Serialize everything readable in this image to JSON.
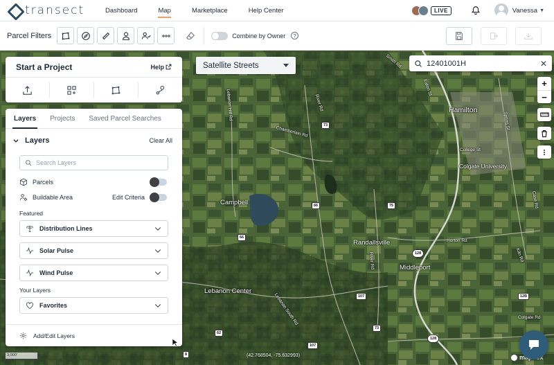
{
  "brand": {
    "name": "transect"
  },
  "nav": {
    "links": [
      {
        "label": "Dashboard"
      },
      {
        "label": "Map"
      },
      {
        "label": "Marketplace"
      },
      {
        "label": "Help Center"
      }
    ],
    "active": "Map",
    "live_badge": "LIVE",
    "user_name": "Vanessa"
  },
  "toolbar": {
    "label": "Parcel Filters",
    "filter_icons": [
      "polygon-select-icon",
      "compass-icon",
      "ruler-icon",
      "person-icon",
      "people-icon",
      "more-icon"
    ],
    "combine_label": "Combine by Owner",
    "combine_enabled": false
  },
  "map": {
    "style_select": "Satellite Streets",
    "search_value": "12401001H",
    "coords": "(42.768504, -75.632993)",
    "scale_label": "3,000'",
    "attribution": "mapbox",
    "places": [
      {
        "name": "Hamilton",
        "kind": "big"
      },
      {
        "name": "Colgate University",
        "kind": "town"
      },
      {
        "name": "Campbell",
        "kind": "town"
      },
      {
        "name": "Randallsville",
        "kind": "town"
      },
      {
        "name": "Middleport",
        "kind": "town"
      },
      {
        "name": "Lebanon Center",
        "kind": "town"
      }
    ],
    "roads": [
      "Smith Rd",
      "River Rd",
      "Eaton St",
      "Lebanon Hill Rd",
      "Chamberlain Rd",
      "Spring St",
      "College St",
      "Horton Rd",
      "Case Rd",
      "River Rd",
      "Lebanon South Rd",
      "Kiln Rd",
      "Colgate Rd"
    ],
    "shields": [
      "73",
      "66",
      "75",
      "66",
      "128",
      "107",
      "73",
      "62",
      "128",
      "107",
      "8",
      "12B"
    ]
  },
  "start_project": {
    "title": "Start a Project",
    "help": "Help",
    "tools": [
      "upload-icon",
      "add-grid-icon",
      "draw-polygon-icon",
      "route-icon"
    ]
  },
  "layers_panel": {
    "tabs": [
      "Layers",
      "Projects",
      "Saved Parcel Searches"
    ],
    "active_tab": "Layers",
    "heading": "Layers",
    "clear_all": "Clear All",
    "search_placeholder": "Search Layers",
    "rows": [
      {
        "label": "Parcels",
        "enabled": false
      },
      {
        "label": "Buildable Area",
        "edit": "Edit Criteria",
        "enabled": false
      }
    ],
    "featured_label": "Featured",
    "featured": [
      "Distribution Lines",
      "Solar Pulse",
      "Wind Pulse"
    ],
    "your_layers_label": "Your Layers",
    "your_layers": [
      "Favorites"
    ],
    "footer": "Add/Edit Layers"
  }
}
